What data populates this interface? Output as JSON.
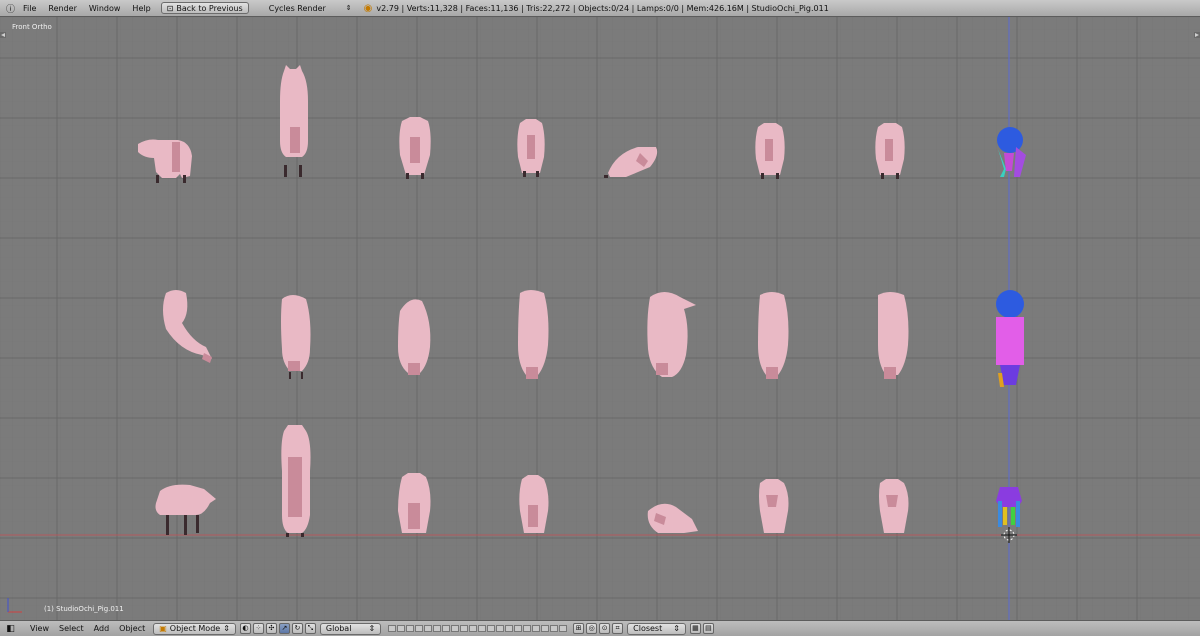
{
  "topbar": {
    "menus": [
      "File",
      "Render",
      "Window",
      "Help"
    ],
    "back_button": "Back to Previous",
    "engine": "Cycles Render",
    "stats": "v2.79 | Verts:11,328 | Faces:11,136 | Tris:22,272 | Objects:0/24 | Lamps:0/0 | Mem:426.16M | StudioOchi_Pig.011"
  },
  "viewport": {
    "view_name": "Front Ortho",
    "active_object": "(1) StudioOchi_Pig.011",
    "colors": {
      "background": "#7b7b7b",
      "grid": "#6c6c6c",
      "pig": "#e9b9c5",
      "pig_shade": "#c98b9a",
      "x_axis": "#c0565a",
      "z_axis": "#5a6ad0"
    }
  },
  "bottombar": {
    "menus": [
      "View",
      "Select",
      "Add",
      "Object"
    ],
    "mode": "Object Mode",
    "orientation": "Global",
    "snap": "Closest"
  }
}
